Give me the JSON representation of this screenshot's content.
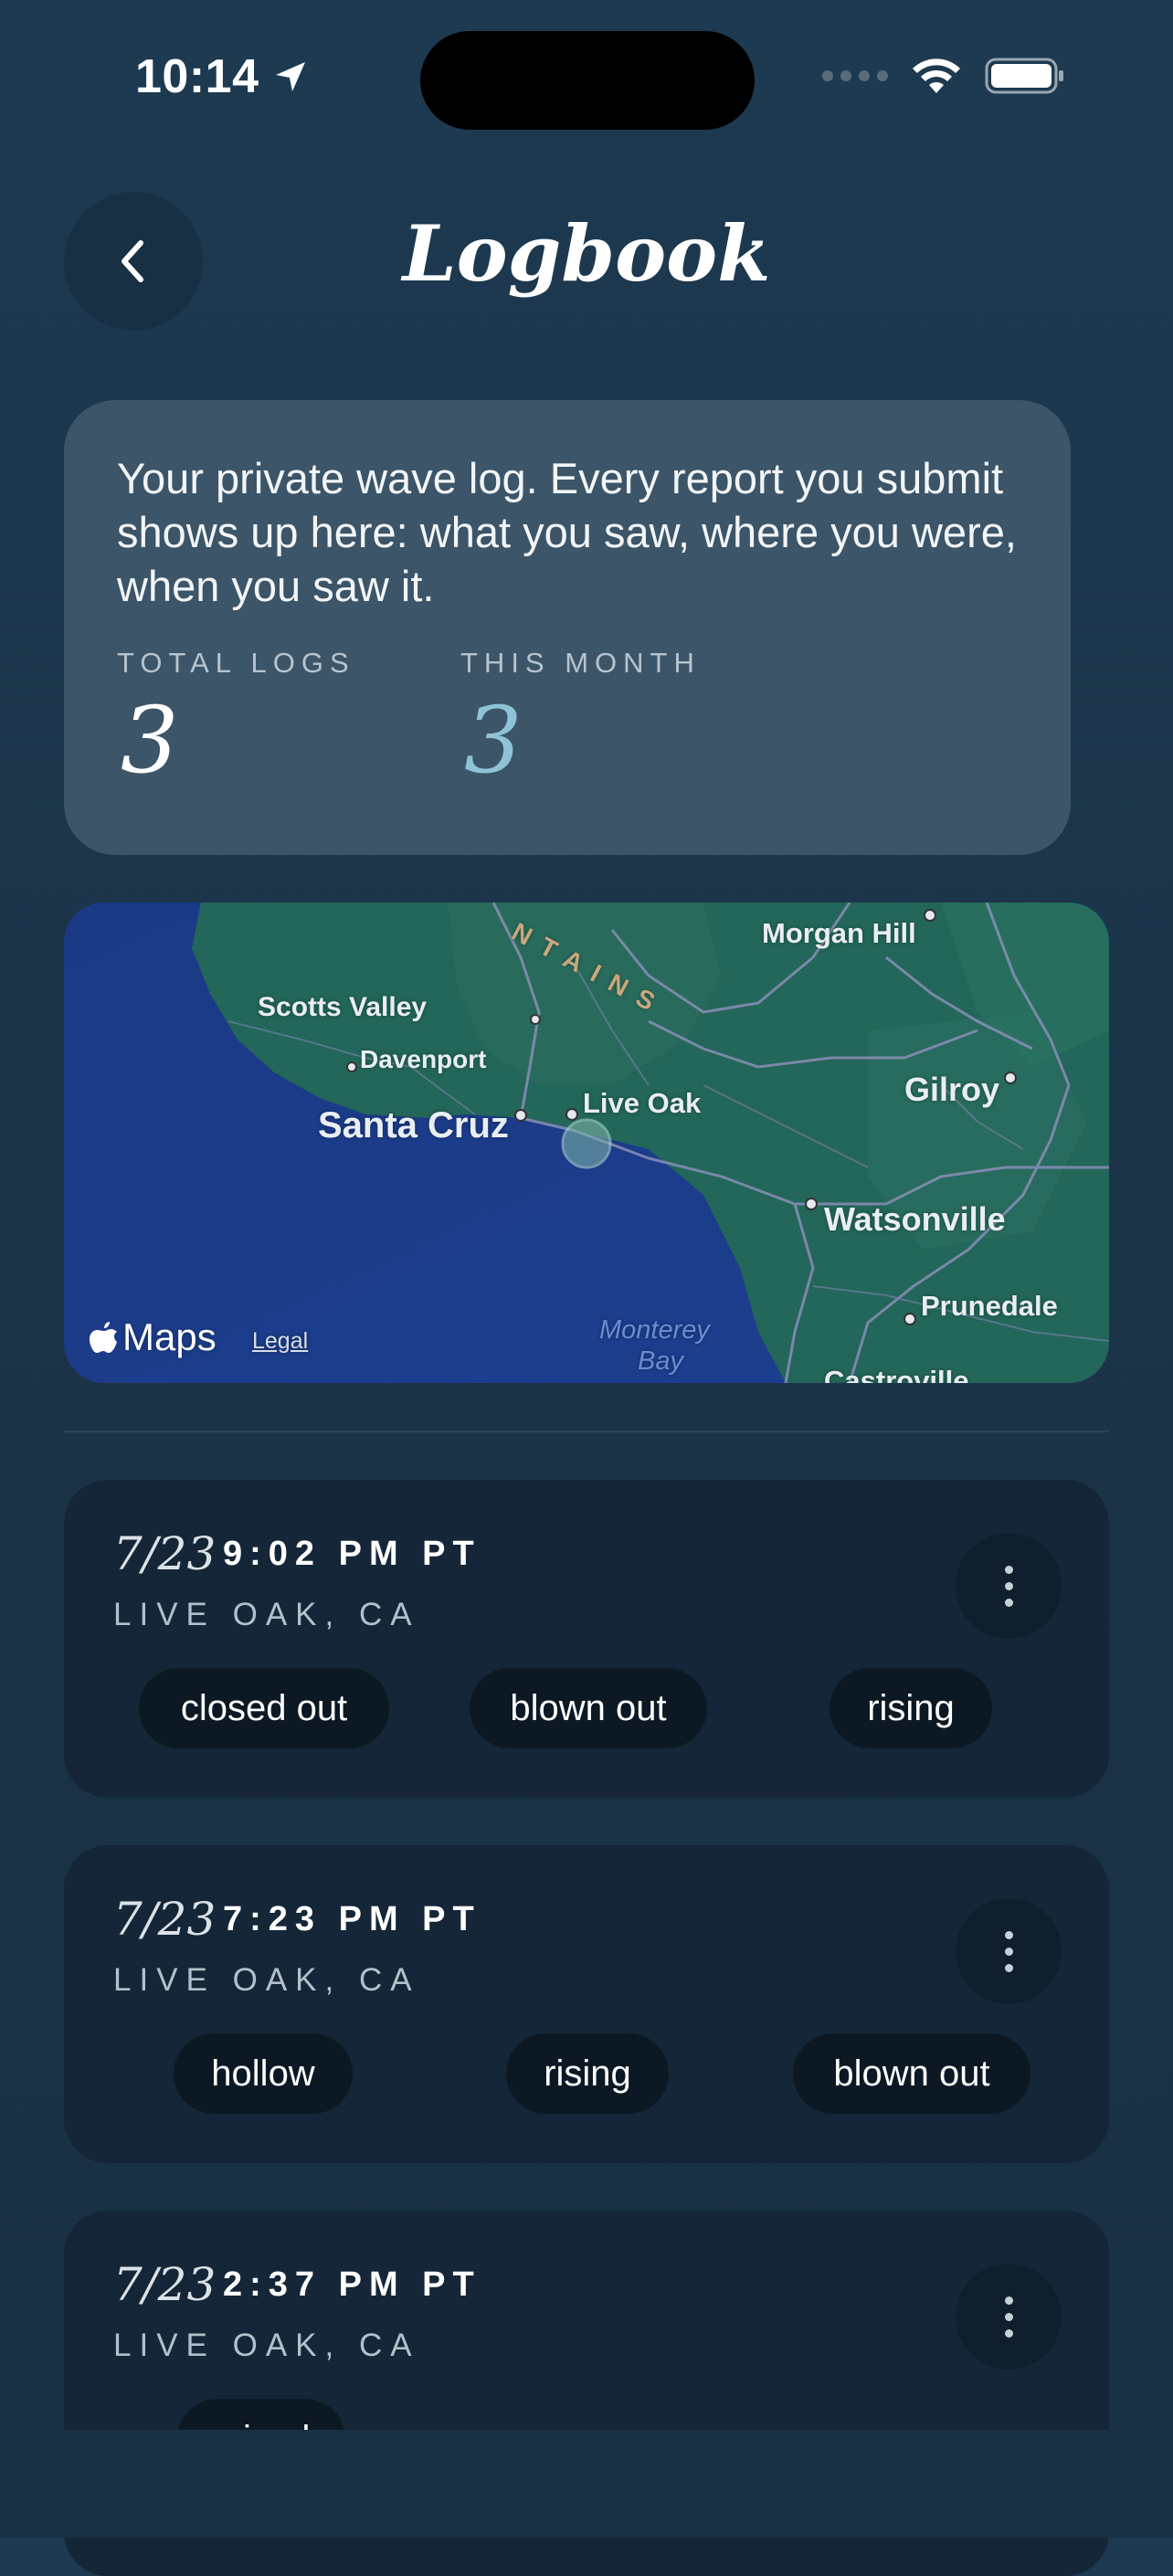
{
  "status_bar": {
    "time": "10:14"
  },
  "header": {
    "title": "Logbook"
  },
  "intro": {
    "description": "Your private wave log. Every report you submit shows up here: what you saw, where you were, when you saw it.",
    "stats": [
      {
        "label": "TOTAL LOGS",
        "value": "3"
      },
      {
        "label": "THIS MONTH",
        "value": "3"
      }
    ]
  },
  "map": {
    "labels": {
      "santa_cruz": "Santa Cruz",
      "live_oak": "Live Oak",
      "scotts_valley": "Scotts Valley",
      "davenport": "Davenport",
      "morgan_hill": "Morgan Hill",
      "gilroy": "Gilroy",
      "watsonville": "Watsonville",
      "prunedale": "Prunedale",
      "castroville": "Castroville",
      "monterey_bay_1": "Monterey",
      "monterey_bay_2": "Bay",
      "mountains": "NTAINS"
    },
    "attribution": "Maps",
    "legal": "Legal"
  },
  "logs": [
    {
      "date": "7/23",
      "time": "9:02 PM PT",
      "location": "LIVE OAK, CA",
      "tags": [
        "closed out",
        "blown out",
        "rising"
      ]
    },
    {
      "date": "7/23",
      "time": "7:23 PM PT",
      "location": "LIVE OAK, CA",
      "tags": [
        "hollow",
        "rising",
        "blown out"
      ]
    },
    {
      "date": "7/23",
      "time": "2:37 PM PT",
      "location": "LIVE OAK, CA",
      "tags": [
        "mixed"
      ]
    }
  ],
  "colors": {
    "background": "#1c3448",
    "card": "#3c5568",
    "log_card": "#142637",
    "accent_month": "#8ec3d6"
  }
}
